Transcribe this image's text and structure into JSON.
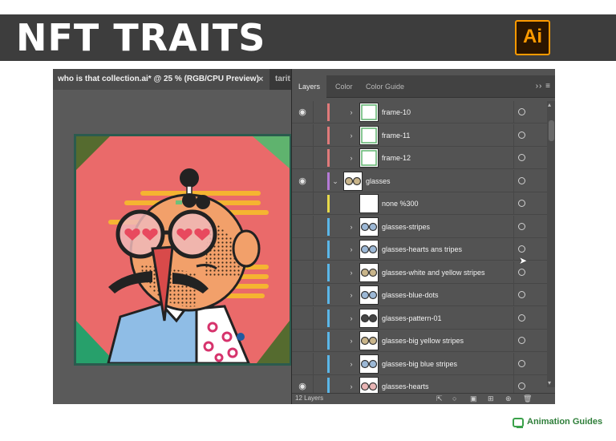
{
  "banner": {
    "title": "NFT TRAITS",
    "app_logo_text": "Ai"
  },
  "document": {
    "active_tab": "who is that collection.ai* @ 25 % (RGB/CPU Preview)",
    "active_tab_close": "×",
    "second_tab": "tarit"
  },
  "panel": {
    "tabs": [
      {
        "label": "Layers",
        "active": true
      },
      {
        "label": "Color",
        "active": false
      },
      {
        "label": "Color Guide",
        "active": false
      }
    ],
    "menu_glyphs": "›› ≡",
    "layer_count": "12 Layers",
    "rows": [
      {
        "name": "frame-10",
        "visible": true,
        "expand": "›",
        "bar": "#e07a7a",
        "indent": 1
      },
      {
        "name": "frame-11",
        "visible": false,
        "expand": "›",
        "bar": "#e07a7a",
        "indent": 1
      },
      {
        "name": "frame-12",
        "visible": false,
        "expand": "›",
        "bar": "#e07a7a",
        "indent": 1
      },
      {
        "name": "glasses",
        "visible": true,
        "expand": "⌄",
        "bar": "#b57ad6",
        "indent": 0
      },
      {
        "name": "none %300",
        "visible": false,
        "expand": "",
        "bar": "#e6d94a",
        "indent": 1
      },
      {
        "name": "glasses-stripes",
        "visible": false,
        "expand": "›",
        "bar": "#5ab6e8",
        "indent": 1
      },
      {
        "name": "glasses-hearts ans tripes",
        "visible": false,
        "expand": "›",
        "bar": "#5ab6e8",
        "indent": 1
      },
      {
        "name": "glasses-white and yellow stripes",
        "visible": false,
        "expand": "›",
        "bar": "#5ab6e8",
        "indent": 1
      },
      {
        "name": "glasses-blue-dots",
        "visible": false,
        "expand": "›",
        "bar": "#5ab6e8",
        "indent": 1
      },
      {
        "name": "glasses-pattern-01",
        "visible": false,
        "expand": "›",
        "bar": "#5ab6e8",
        "indent": 1
      },
      {
        "name": "glasses-big yellow stripes",
        "visible": false,
        "expand": "›",
        "bar": "#5ab6e8",
        "indent": 1
      },
      {
        "name": "glasses-big blue stripes",
        "visible": false,
        "expand": "›",
        "bar": "#5ab6e8",
        "indent": 1
      },
      {
        "name": "glasses-hearts",
        "visible": true,
        "expand": "›",
        "bar": "#5ab6e8",
        "indent": 1
      }
    ]
  },
  "brand": {
    "text": "Animation Guides"
  },
  "colors": {
    "banner_bg": "#3d3d3d",
    "ai_orange": "#ff9a00",
    "panel_bg": "#535353",
    "artwork_bg": "#ea6a6a",
    "artwork_corner_green": "#5fb36e",
    "brand_green": "#3aa14a"
  }
}
